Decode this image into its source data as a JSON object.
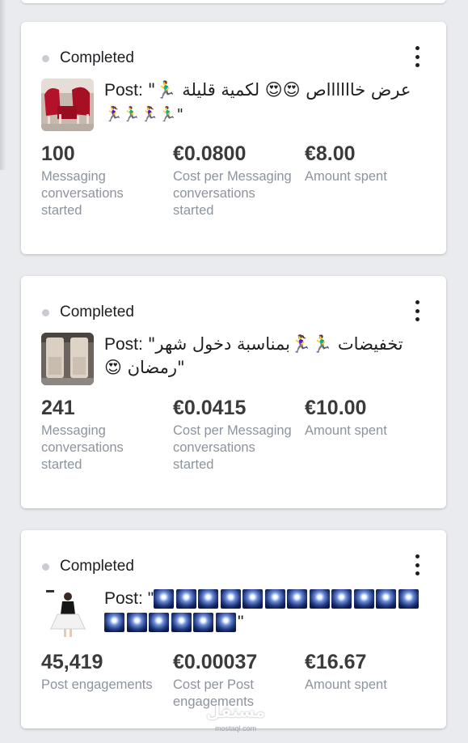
{
  "cards": [
    {
      "status": "Completed",
      "thumb_icon": "chairs-thumbnail",
      "post_label": "Post: ",
      "post_text": "\"🏃‍♂️ عرض خااااااص 😍😍 لكمية قليلة",
      "post_tail": "🏃‍♀️🏃‍♂️🏃‍♀️🏃‍♂️\"",
      "metrics": [
        {
          "value": "100",
          "caption": "Messaging conversations started"
        },
        {
          "value": "€0.0800",
          "caption": "Cost per Messaging conversations started"
        },
        {
          "value": "€8.00",
          "caption": "Amount spent"
        }
      ]
    },
    {
      "status": "Completed",
      "thumb_icon": "furniture-thumbnail",
      "post_label": "Post: ",
      "post_text": "\"تخفيضات 🏃‍♂️🏃‍♀️بمناسبة دخول شهر",
      "post_tail": "😍 رمضان\"",
      "metrics": [
        {
          "value": "241",
          "caption": "Messaging conversations started"
        },
        {
          "value": "€0.0415",
          "caption": "Cost per Messaging conversations started"
        },
        {
          "value": "€10.00",
          "caption": "Amount spent"
        }
      ]
    },
    {
      "status": "Completed",
      "thumb_icon": "dress-thumbnail",
      "post_label": "Post: \"",
      "post_tail": "\"",
      "sparkles_row1": 12,
      "sparkles_row2": 6,
      "metrics": [
        {
          "value": "45,419",
          "caption": "Post engagements"
        },
        {
          "value": "€0.00037",
          "caption": "Cost per Post engagements"
        },
        {
          "value": "€16.67",
          "caption": "Amount spent"
        }
      ]
    }
  ],
  "watermark": {
    "main": "مستقل",
    "sub": "mostaql.com"
  }
}
